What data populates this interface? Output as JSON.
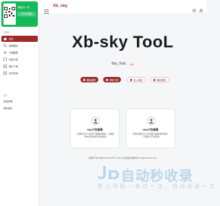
{
  "header": {
    "site_title": "Xb_sky"
  },
  "sidebar": {
    "promo_title": "微信扫一扫",
    "promo_pill": "sky小白庙画",
    "section_main": "导航栏",
    "items": [
      {
        "label": "首页",
        "active": true
      },
      {
        "label": "推荐图标",
        "active": false
      },
      {
        "label": "卡图配置",
        "active": false
      },
      {
        "label": "安装卡密",
        "active": false
      },
      {
        "label": "图片订单",
        "active": false
      },
      {
        "label": "历史查询",
        "active": false
      }
    ],
    "section_other": "其它",
    "other_items": [
      {
        "label": "热搜声明"
      },
      {
        "label": "联系我们"
      }
    ]
  },
  "hero": {
    "title": "Xb-sky TooL",
    "subtitle": "Sky_TooL",
    "badge": "2.0"
  },
  "buttons": [
    {
      "label": "模板模型",
      "style": "primary"
    },
    {
      "label": "获取卡密",
      "style": "primary"
    },
    {
      "label": "加入频道",
      "style": "outline"
    },
    {
      "label": "使用教程",
      "style": "outline"
    }
  ],
  "cards": [
    {
      "title": "sky小白庙画",
      "text": "捐赠我也可以捐献于需要的帮助，正确使用本站请勿取消您的图片"
    },
    {
      "title": "sky小白庙画",
      "text": "捐赠本服务可以支持我们继续维修服务，不再执行开发变换"
    }
  ],
  "footer": {
    "text": "备案号 粤ICP备2023XXXX号 © 2023 小白庙画 版权所有 All Rights Reserved."
  },
  "watermark": {
    "main": "自动秒收录",
    "sub": "数 上 导 航 — 来 访 一 次 ， 自 动 收 录 一 次"
  },
  "colors": {
    "accent": "#9b2c2c",
    "promo": "#14b95a",
    "watermark": "#b9d7ec"
  }
}
